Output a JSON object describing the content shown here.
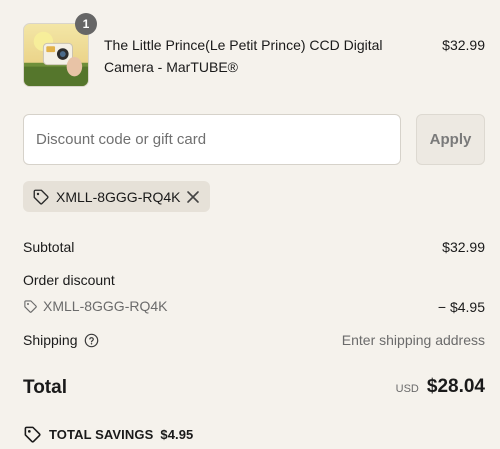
{
  "cart": {
    "item": {
      "quantity": "1",
      "title": "The Little Prince(Le Petit Prince) CCD Digital Camera - MarTUBE®",
      "price": "$32.99"
    }
  },
  "discount": {
    "placeholder": "Discount code or gift card",
    "value": "",
    "apply_label": "Apply",
    "applied_code": "XMLL-8GGG-RQ4K"
  },
  "summary": {
    "subtotal_label": "Subtotal",
    "subtotal_value": "$32.99",
    "order_discount_label": "Order discount",
    "discount_code": "XMLL-8GGG-RQ4K",
    "discount_amount": "− $4.95",
    "shipping_label": "Shipping",
    "shipping_value": "Enter shipping address",
    "total_label": "Total",
    "currency": "USD",
    "total_amount": "$28.04",
    "savings_label": "TOTAL SAVINGS",
    "savings_amount": "$4.95"
  },
  "icons": {
    "tag": "tag-icon",
    "close": "close-icon",
    "help": "help-circle-icon",
    "savings_tag": "savings-tag-icon"
  },
  "colors": {
    "background": "#f5f2ec",
    "chip_background": "#e6e1d8",
    "badge": "#666666",
    "muted_text": "#6b6b6b"
  }
}
